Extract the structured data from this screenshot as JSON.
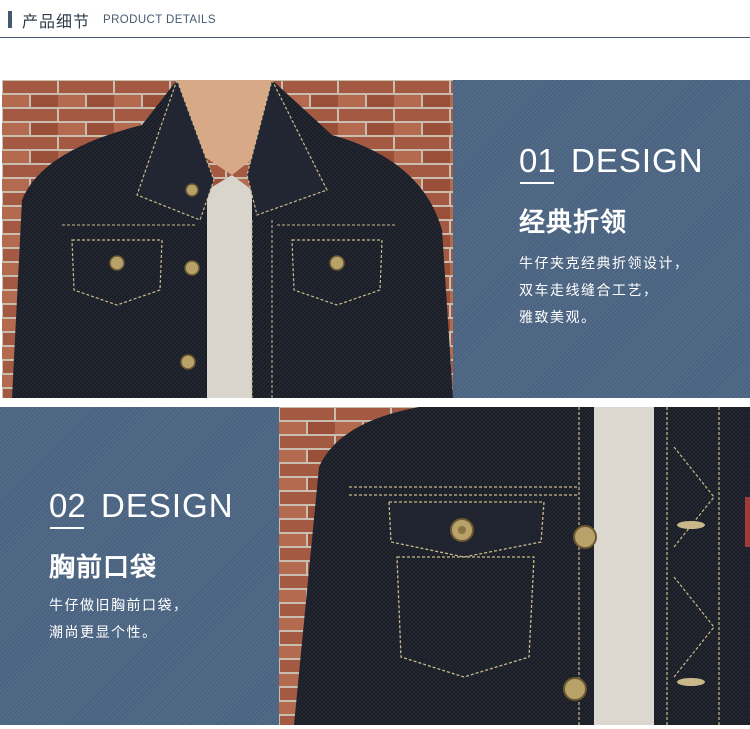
{
  "header": {
    "title_cn": "产品细节",
    "title_en": "PRODUCT DETAILS"
  },
  "sections": [
    {
      "number": "01",
      "word": "DESIGN",
      "title": "经典折领",
      "lines": [
        "牛仔夹克经典折领设计，",
        "双车走线缝合工艺，",
        "雅致美观。"
      ]
    },
    {
      "number": "02",
      "word": "DESIGN",
      "title": "胸前口袋",
      "lines": [
        "牛仔做旧胸前口袋，",
        "潮尚更显个性。"
      ]
    }
  ],
  "colors": {
    "panel_blue": "#4a6381",
    "header_accent": "#45596f",
    "denim_dark": "#1b1e27",
    "stitch": "#c9b98a",
    "brick": "#a65a43"
  }
}
